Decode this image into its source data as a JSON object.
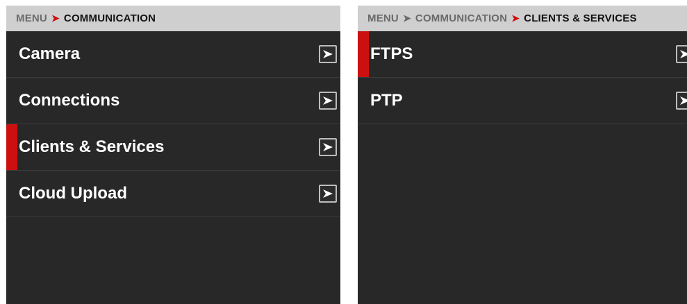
{
  "left_panel": {
    "breadcrumb": [
      {
        "text": "MENU",
        "active": false
      },
      {
        "text": "COMMUNICATION",
        "active": true
      }
    ],
    "items": [
      {
        "label": "Camera",
        "selected": false
      },
      {
        "label": "Connections",
        "selected": false
      },
      {
        "label": "Clients & Services",
        "selected": true
      },
      {
        "label": "Cloud Upload",
        "selected": false
      }
    ]
  },
  "right_panel": {
    "breadcrumb": [
      {
        "text": "MENU",
        "active": false
      },
      {
        "text": "COMMUNICATION",
        "active": false
      },
      {
        "text": "CLIENTS & SERVICES",
        "active": true
      }
    ],
    "items": [
      {
        "label": "FTPS",
        "selected": true
      },
      {
        "label": "PTP",
        "selected": false
      }
    ]
  },
  "icons": {
    "row_arrow": "chevron-right-icon",
    "breadcrumb_separator": "chevron-right-icon"
  },
  "colors": {
    "accent": "#cc1010",
    "panel_bg": "#282828",
    "header_bg": "#cfcfcf"
  }
}
